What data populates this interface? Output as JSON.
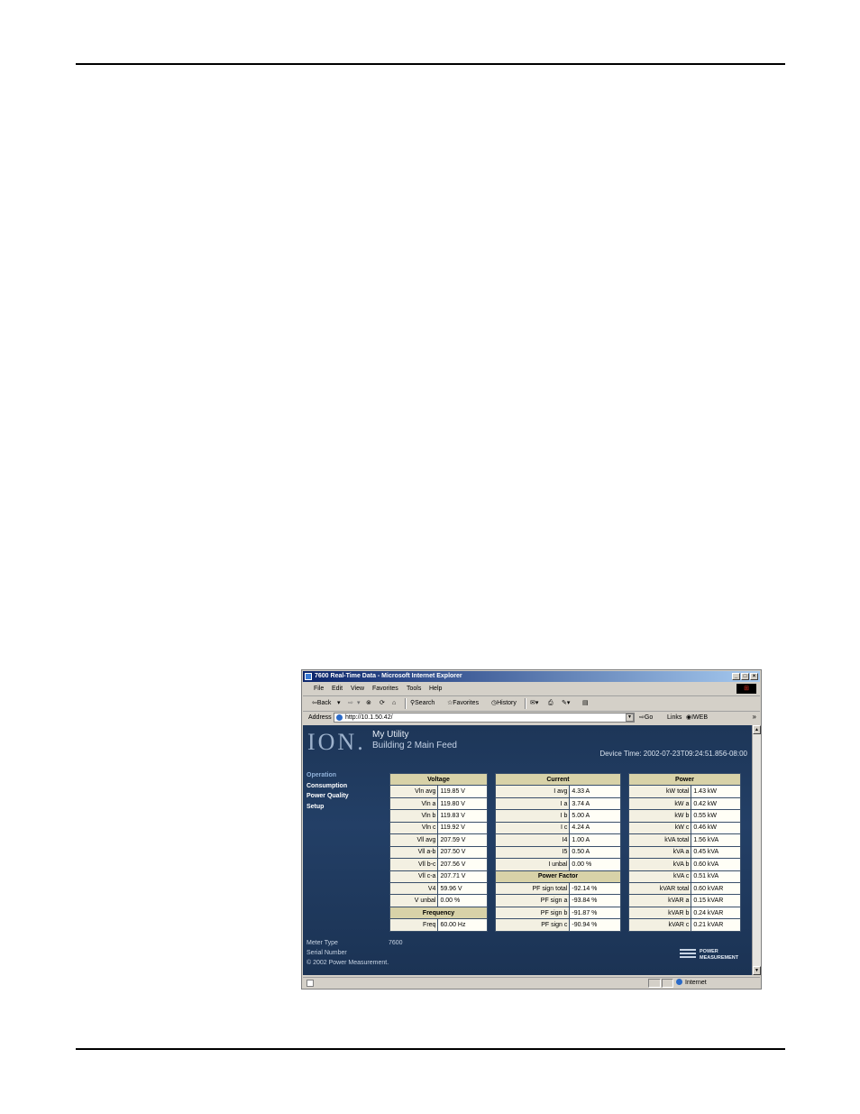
{
  "window": {
    "title": "7600 Real-Time Data - Microsoft Internet Explorer",
    "controls": {
      "minimize": "_",
      "maximize": "□",
      "close": "×"
    }
  },
  "menu": [
    "File",
    "Edit",
    "View",
    "Favorites",
    "Tools",
    "Help"
  ],
  "toolbar": {
    "back": "⇦Back",
    "forward": "⇨",
    "search": "Search",
    "favorites": "Favorites",
    "history": "History"
  },
  "address": {
    "label": "Address",
    "url": "http://10.1.50.42/",
    "go": "Go",
    "links": "Links",
    "link1": "IWEB",
    "more": "»"
  },
  "page": {
    "logo": "ION.",
    "title": "My Utility",
    "subtitle": "Building 2 Main Feed",
    "device_time": "Device Time: 2002-07-23T09:24:51.856-08:00",
    "nav": [
      "Operation",
      "Consumption",
      "Power Quality",
      "Setup"
    ],
    "voltage": {
      "header": "Voltage",
      "rows": [
        [
          "Vln avg",
          "119.85 V"
        ],
        [
          "Vln a",
          "119.80 V"
        ],
        [
          "Vln b",
          "119.83 V"
        ],
        [
          "Vln c",
          "119.92 V"
        ],
        [
          "Vll avg",
          "207.59 V"
        ],
        [
          "Vll a-b",
          "207.50 V"
        ],
        [
          "Vll b-c",
          "207.56 V"
        ],
        [
          "Vll c-a",
          "207.71 V"
        ],
        [
          "V4",
          "59.96 V"
        ],
        [
          "V unbal",
          "0.00 %"
        ]
      ]
    },
    "frequency": {
      "header": "Frequency",
      "rows": [
        [
          "Freq",
          "60.00 Hz"
        ]
      ]
    },
    "current": {
      "header": "Current",
      "rows": [
        [
          "I avg",
          "4.33 A"
        ],
        [
          "I a",
          "3.74 A"
        ],
        [
          "I b",
          "5.00 A"
        ],
        [
          "I c",
          "4.24 A"
        ],
        [
          "I4",
          "1.00 A"
        ],
        [
          "I5",
          "0.50 A"
        ],
        [
          "I unbal",
          "0.00 %"
        ]
      ]
    },
    "power_factor": {
      "header": "Power Factor",
      "rows": [
        [
          "PF sign total",
          "-92.14 %"
        ],
        [
          "PF sign a",
          "-93.84 %"
        ],
        [
          "PF sign b",
          "-91.87 %"
        ],
        [
          "PF sign c",
          "-90.94 %"
        ]
      ]
    },
    "power": {
      "header": "Power",
      "rows": [
        [
          "kW total",
          "1.43 kW"
        ],
        [
          "kW a",
          "0.42 kW"
        ],
        [
          "kW b",
          "0.55 kW"
        ],
        [
          "kW c",
          "0.46 kW"
        ],
        [
          "kVA total",
          "1.56 kVA"
        ],
        [
          "kVA a",
          "0.45 kVA"
        ],
        [
          "kVA b",
          "0.60 kVA"
        ],
        [
          "kVA c",
          "0.51 kVA"
        ],
        [
          "kVAR total",
          "0.60 kVAR"
        ],
        [
          "kVAR a",
          "0.15 kVAR"
        ],
        [
          "kVAR b",
          "0.24 kVAR"
        ],
        [
          "kVAR c",
          "0.21 kVAR"
        ]
      ]
    },
    "footer": {
      "meter_type_label": "Meter Type",
      "meter_type_value": "7600",
      "serial_label": "Serial Number",
      "copyright": "© 2002 Power Measurement."
    },
    "brand": {
      "line1": "POWER",
      "line2": "MEASUREMENT"
    }
  },
  "status": {
    "zone": "Internet"
  }
}
